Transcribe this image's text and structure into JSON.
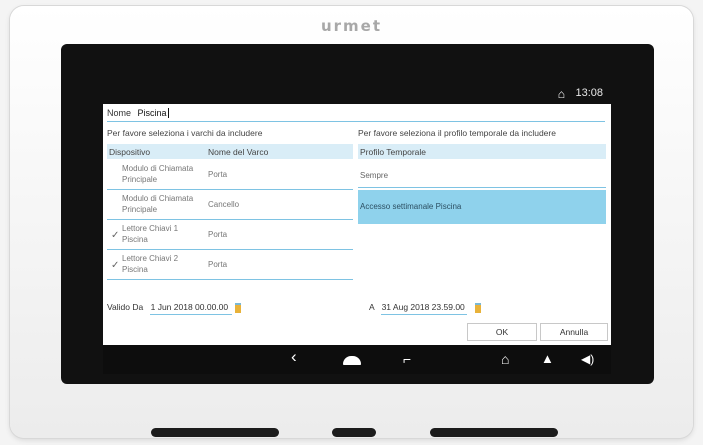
{
  "device": {
    "brand": "urmet"
  },
  "statusbar": {
    "home_icon": "home-icon",
    "time": "13:08"
  },
  "form": {
    "name_label": "Nome",
    "name_value": "Piscina",
    "left_title": "Per favore seleziona i varchi da includere",
    "right_title": "Per favore seleziona il profilo temporale da includere",
    "gates_table": {
      "headers": [
        "Dispositivo",
        "Nome del Varco"
      ],
      "rows": [
        {
          "checked": false,
          "device": "Modulo di Chiamata Principale",
          "gate": "Porta"
        },
        {
          "checked": false,
          "device": "Modulo di Chiamata Principale",
          "gate": "Cancello"
        },
        {
          "checked": true,
          "device": "Lettore Chiavi 1 Piscina",
          "gate": "Porta"
        },
        {
          "checked": true,
          "device": "Lettore Chiavi 2 Piscina",
          "gate": "Porta"
        }
      ]
    },
    "profiles_table": {
      "header": "Profilo Temporale",
      "rows": [
        {
          "label": "Sempre",
          "selected": false
        },
        {
          "label": "Accesso settimanale Piscina",
          "selected": true
        }
      ]
    },
    "valid_from_label": "Valido Da",
    "valid_from_value": "1 Jun 2018 00.00.00",
    "valid_to_label": "A",
    "valid_to_value": "31 Aug 2018 23.59.00",
    "ok_label": "OK",
    "cancel_label": "Annulla"
  },
  "navbar": {
    "icons": [
      "back-icon",
      "cloud-icon",
      "recent-apps-icon",
      "home-icon",
      "bell-icon",
      "volume-icon"
    ]
  },
  "colors": {
    "selection": "#8fd2ec",
    "header_bg": "#d9edf7",
    "underline": "#7ec3e3",
    "calendar_icon": "#e8b23a"
  }
}
